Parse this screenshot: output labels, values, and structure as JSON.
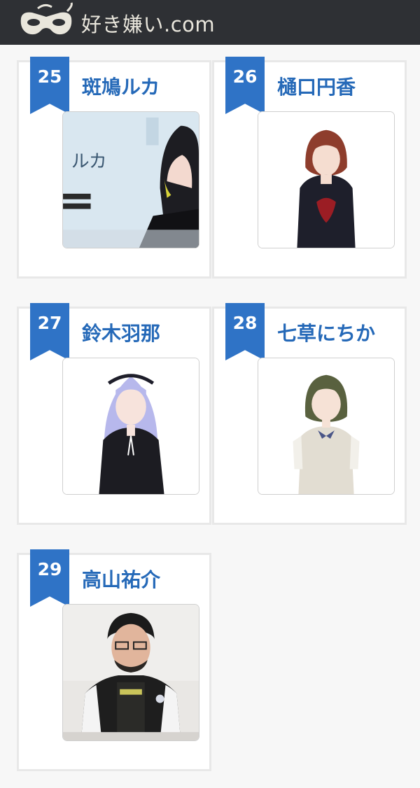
{
  "header": {
    "site_title": "好き嫌い.com",
    "logo_icon": "mask-logo-icon",
    "background": "#2e3034"
  },
  "accent_color": "#2f73c6",
  "name_color": "#2569b8",
  "cards": [
    {
      "rank": "25",
      "name": "斑鳩ルカ",
      "image_caption": "ルカ",
      "image": "character-illustration"
    },
    {
      "rank": "26",
      "name": "樋口円香",
      "image": "character-illustration"
    },
    {
      "rank": "27",
      "name": "鈴木羽那",
      "image": "character-illustration"
    },
    {
      "rank": "28",
      "name": "七草にちか",
      "image": "character-illustration"
    },
    {
      "rank": "29",
      "name": "高山祐介",
      "image": "person-photo"
    }
  ]
}
